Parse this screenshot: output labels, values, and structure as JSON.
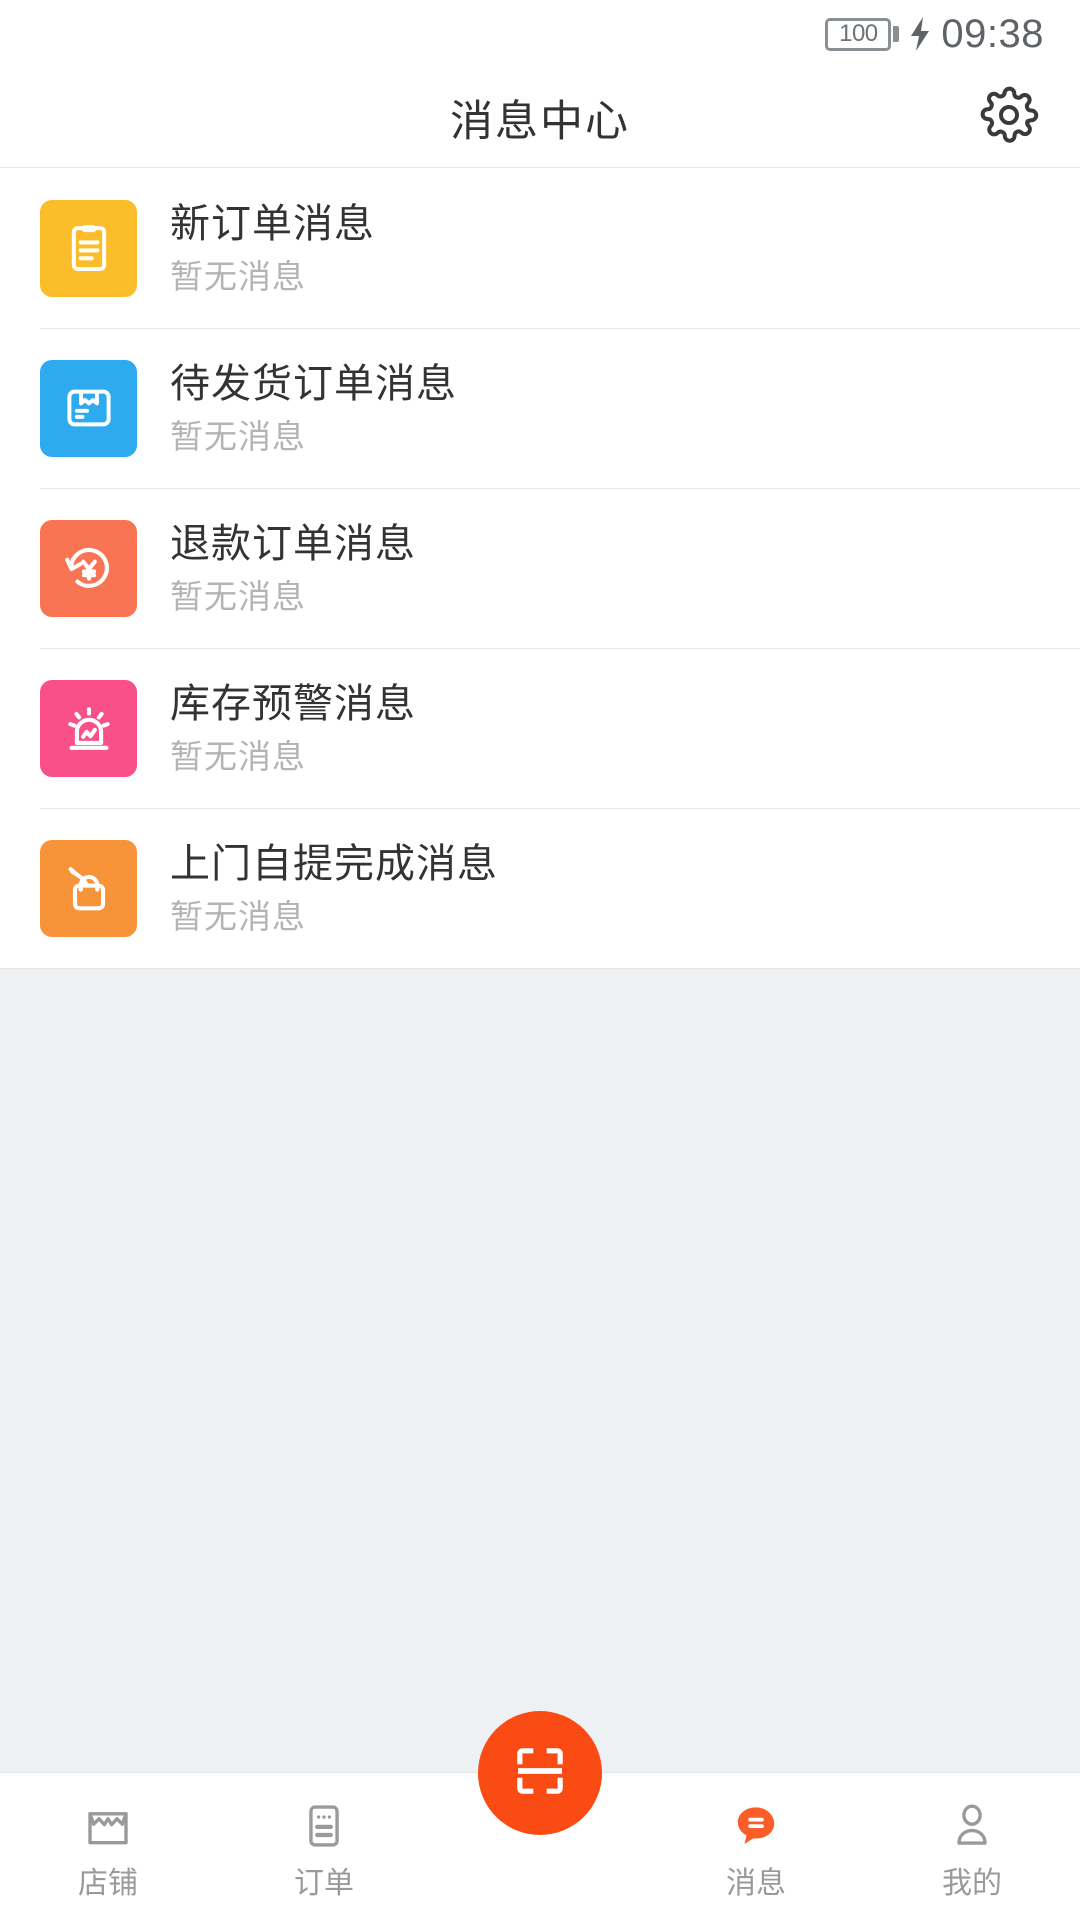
{
  "status_bar": {
    "battery_level": "100",
    "battery_icon": "battery-icon",
    "charging_icon": "charging-bolt-icon",
    "time": "09:38"
  },
  "header": {
    "title": "消息中心",
    "settings_icon": "gear-icon"
  },
  "messages": {
    "items": [
      {
        "title": "新订单消息",
        "subtitle": "暂无消息",
        "icon": "clipboard-icon",
        "color": "#fcbd2a"
      },
      {
        "title": "待发货订单消息",
        "subtitle": "暂无消息",
        "icon": "package-box-icon",
        "color": "#2eaaef"
      },
      {
        "title": "退款订单消息",
        "subtitle": "暂无消息",
        "icon": "refund-yuan-icon",
        "color": "#f97452"
      },
      {
        "title": "库存预警消息",
        "subtitle": "暂无消息",
        "icon": "alarm-siren-icon",
        "color": "#f9508a"
      },
      {
        "title": "上门自提完成消息",
        "subtitle": "暂无消息",
        "icon": "pickup-bag-icon",
        "color": "#f79338"
      }
    ]
  },
  "tabbar": {
    "items": [
      {
        "label": "店铺",
        "icon": "shop-icon",
        "active": false
      },
      {
        "label": "订单",
        "icon": "order-list-icon",
        "active": false
      },
      {
        "label": "消息",
        "icon": "message-bubble-icon",
        "active": true
      },
      {
        "label": "我的",
        "icon": "user-profile-icon",
        "active": false
      }
    ],
    "center_button": {
      "icon": "scan-qr-icon",
      "color": "#fb4b14"
    }
  },
  "colors": {
    "accent": "#fb4b14",
    "page_background": "#eef1f4",
    "card_background": "#ffffff",
    "title_text": "#333333",
    "muted_text": "#b4b4b4",
    "tab_label": "#9a9a9a"
  }
}
